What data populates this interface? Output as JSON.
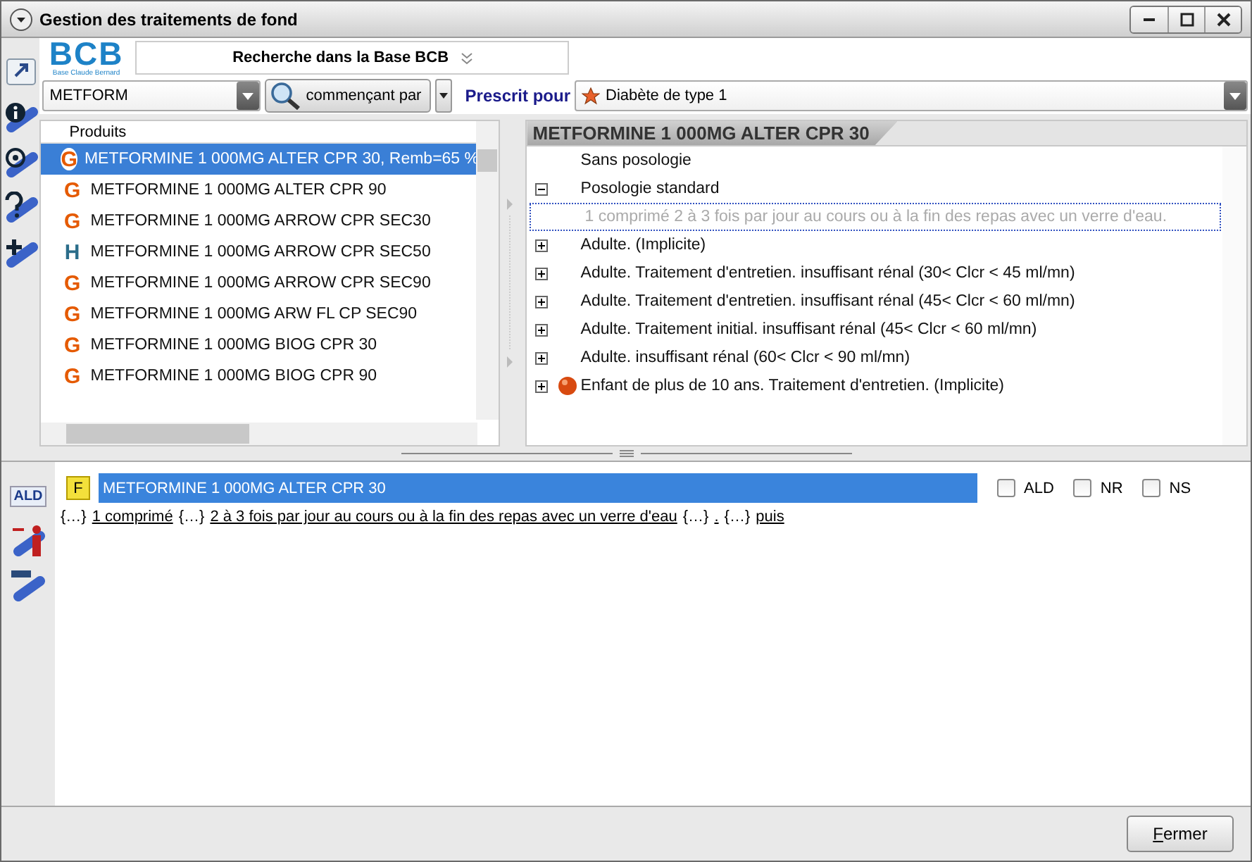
{
  "window": {
    "title": "Gestion des traitements de fond"
  },
  "logo": {
    "text": "BCB",
    "subtitle": "Base Claude Bernard"
  },
  "search": {
    "header": "Recherche dans la Base BCB",
    "value": "METFORM",
    "mode": "commençant par",
    "prescribed_label": "Prescrit pour",
    "prescribed_value": "Diabète de type 1"
  },
  "products": {
    "column": "Produits",
    "items": [
      {
        "badge": "G",
        "name": "METFORMINE 1 000MG ALTER CPR 30, Remb=65 %",
        "selected": true
      },
      {
        "badge": "G",
        "name": "METFORMINE 1 000MG ALTER CPR 90",
        "selected": false
      },
      {
        "badge": "G",
        "name": "METFORMINE 1 000MG ARROW CPR SEC30",
        "selected": false
      },
      {
        "badge": "H",
        "name": "METFORMINE 1 000MG ARROW CPR SEC50",
        "selected": false
      },
      {
        "badge": "G",
        "name": "METFORMINE 1 000MG ARROW CPR SEC90",
        "selected": false
      },
      {
        "badge": "G",
        "name": "METFORMINE 1 000MG ARW FL CP SEC90",
        "selected": false
      },
      {
        "badge": "G",
        "name": "METFORMINE 1 000MG BIOG CPR 30",
        "selected": false
      },
      {
        "badge": "G",
        "name": "METFORMINE 1 000MG BIOG CPR 90",
        "selected": false
      }
    ]
  },
  "detail": {
    "title": "METFORMINE 1 000MG ALTER CPR 30",
    "rows": [
      {
        "kind": "plain",
        "label": "Sans posologie",
        "alert": false
      },
      {
        "kind": "group",
        "label": "Posologie standard",
        "expanded": true,
        "alert": false,
        "children": [
          {
            "kind": "instruction",
            "label": "1 comprimé  2 à 3 fois par jour au cours ou à la fin des repas avec un verre d'eau."
          }
        ]
      },
      {
        "kind": "group",
        "label": "Adulte. (Implicite)",
        "expanded": false,
        "alert": false
      },
      {
        "kind": "group",
        "label": "Adulte. Traitement d'entretien. insuffisant rénal (30< Clcr < 45 ml/mn)",
        "expanded": false,
        "alert": false
      },
      {
        "kind": "group",
        "label": "Adulte. Traitement d'entretien. insuffisant rénal (45< Clcr < 60 ml/mn)",
        "expanded": false,
        "alert": false
      },
      {
        "kind": "group",
        "label": "Adulte. Traitement initial. insuffisant rénal (45< Clcr < 60 ml/mn)",
        "expanded": false,
        "alert": false
      },
      {
        "kind": "group",
        "label": "Adulte. insuffisant rénal (60< Clcr < 90 ml/mn)",
        "expanded": false,
        "alert": false
      },
      {
        "kind": "group",
        "label": "Enfant de plus de 10 ans. Traitement d'entretien. (Implicite)",
        "expanded": false,
        "alert": true
      }
    ]
  },
  "prescription": {
    "tool_label": "ALD",
    "badge": "F",
    "name": "METFORMINE 1 000MG ALTER CPR 30",
    "flags": [
      {
        "label": "ALD",
        "checked": false
      },
      {
        "label": "NR",
        "checked": false
      },
      {
        "label": "NS",
        "checked": false
      }
    ],
    "segments": [
      {
        "kind": "placeholder",
        "text": "{…}"
      },
      {
        "kind": "link",
        "text": "1 comprimé"
      },
      {
        "kind": "placeholder",
        "text": "{…}"
      },
      {
        "kind": "link",
        "text": "2 à 3 fois par jour au cours ou à la fin des repas avec un verre d'eau"
      },
      {
        "kind": "placeholder",
        "text": "{…}"
      },
      {
        "kind": "link",
        "text": "."
      },
      {
        "kind": "placeholder",
        "text": "{…}"
      },
      {
        "kind": "link",
        "text": "puis"
      }
    ]
  },
  "footer": {
    "close": "Fermer"
  }
}
